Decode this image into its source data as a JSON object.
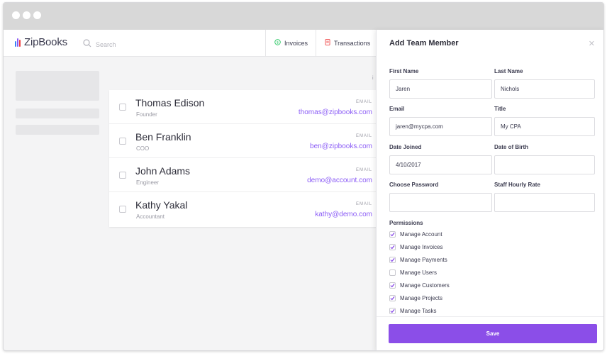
{
  "colors": {
    "accent": "#8b4ee8",
    "email": "#8b5cf6",
    "logo_bars": [
      "#3b82f6",
      "#8b5cf6",
      "#ef4444"
    ]
  },
  "app": {
    "logo": "ZipBooks",
    "search_placeholder": "Search"
  },
  "nav": {
    "items": [
      {
        "label": "Invoices",
        "icon": "dollar-circle-icon"
      },
      {
        "label": "Transactions",
        "icon": "receipt-icon"
      }
    ]
  },
  "list": {
    "column_stub": "i",
    "members": [
      {
        "name": "Thomas Edison",
        "role": "Founder",
        "email_label": "EMAIL",
        "email": "thomas@zipbooks.com"
      },
      {
        "name": "Ben Franklin",
        "role": "COO",
        "email_label": "EMAIL",
        "email": "ben@zipbooks.com"
      },
      {
        "name": "John Adams",
        "role": "Engineer",
        "email_label": "EMAIL",
        "email": "demo@account.com"
      },
      {
        "name": "Kathy Yakal",
        "role": "Accountant",
        "email_label": "EMAIL",
        "email": "kathy@demo.com"
      }
    ]
  },
  "panel": {
    "title": "Add Team Member",
    "fields": {
      "first_name": {
        "label": "First Name",
        "value": "Jaren"
      },
      "last_name": {
        "label": "Last Name",
        "value": "Nichols"
      },
      "email": {
        "label": "Email",
        "value": "jaren@mycpa.com"
      },
      "title": {
        "label": "Title",
        "value": "My CPA"
      },
      "date_joined": {
        "label": "Date Joined",
        "value": "4/10/2017"
      },
      "date_of_birth": {
        "label": "Date of Birth",
        "value": ""
      },
      "password": {
        "label": "Choose Password",
        "value": ""
      },
      "hourly_rate": {
        "label": "Staff Hourly Rate",
        "value": ""
      }
    },
    "permissions_label": "Permissions",
    "permissions": [
      {
        "label": "Manage Account",
        "checked": true
      },
      {
        "label": "Manage Invoices",
        "checked": true
      },
      {
        "label": "Manage Payments",
        "checked": true
      },
      {
        "label": "Manage Users",
        "checked": false
      },
      {
        "label": "Manage Customers",
        "checked": true
      },
      {
        "label": "Manage Projects",
        "checked": true
      },
      {
        "label": "Manage Tasks",
        "checked": true
      }
    ],
    "save_label": "Save"
  }
}
